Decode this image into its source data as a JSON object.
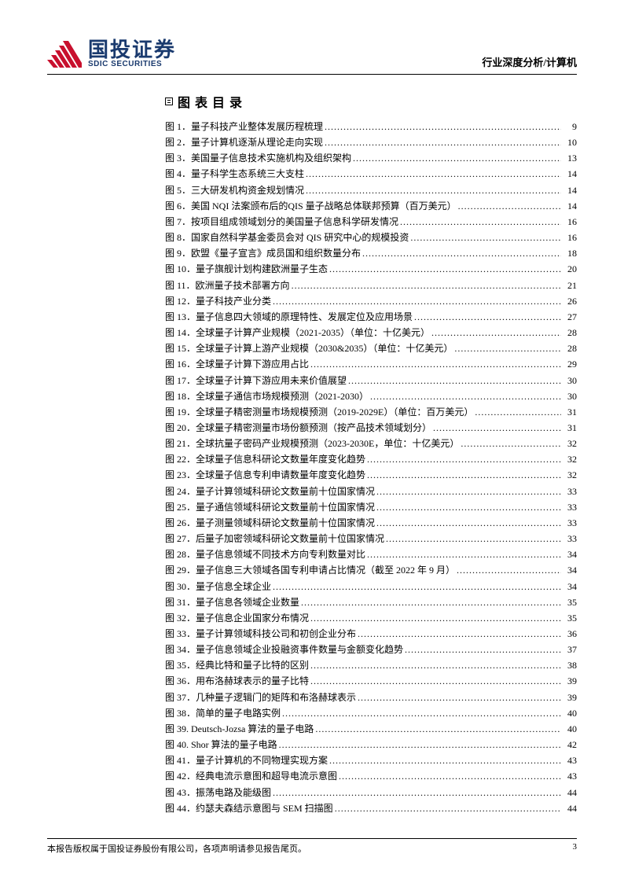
{
  "header": {
    "logo_zh": "国投证券",
    "logo_en": "SDIC SECURITIES",
    "right": "行业深度分析/计算机"
  },
  "toc_title": "图表目录",
  "toc": [
    {
      "label": "图 1．量子科技产业整体发展历程梳理",
      "page": "9"
    },
    {
      "label": "图 2．量子计算机逐渐从理论走向实现",
      "page": "10"
    },
    {
      "label": "图 3．美国量子信息技术实施机构及组织架构",
      "page": "13"
    },
    {
      "label": "图 4．量子科学生态系统三大支柱",
      "page": "14"
    },
    {
      "label": "图 5．三大研发机构资金规划情况",
      "page": "14"
    },
    {
      "label": "图 6．美国 NQI 法案颁布后的QIS 量子战略总体联邦预算（百万美元）",
      "page": "14"
    },
    {
      "label": "图 7．按项目组成领域划分的美国量子信息科学研发情况",
      "page": "16"
    },
    {
      "label": "图 8．国家自然科学基金委员会对 QIS 研究中心的规模投资",
      "page": "16"
    },
    {
      "label": "图 9．欧盟《量子宣言》成员国和组织数量分布",
      "page": "18"
    },
    {
      "label": "图 10．量子旗舰计划构建欧洲量子生态",
      "page": "20"
    },
    {
      "label": "图 11．欧洲量子技术部署方向",
      "page": "21"
    },
    {
      "label": "图 12．量子科技产业分类",
      "page": "26"
    },
    {
      "label": "图 13．量子信息四大领域的原理特性、发展定位及应用场景",
      "page": "27"
    },
    {
      "label": "图 14．全球量子计算产业规模（2021-2035）（单位：十亿美元）",
      "page": "28"
    },
    {
      "label": "图 15．全球量子计算上游产业规模（2030&2035）（单位：十亿美元）",
      "page": "28"
    },
    {
      "label": "图 16．全球量子计算下游应用占比",
      "page": "29"
    },
    {
      "label": "图 17．全球量子计算下游应用未来价值展望",
      "page": "30"
    },
    {
      "label": "图 18．全球量子通信市场规模预测（2021-2030）",
      "page": "30"
    },
    {
      "label": "图 19．全球量子精密测量市场规模预测（2019-2029E）（单位：百万美元）",
      "page": "31"
    },
    {
      "label": "图 20．全球量子精密测量市场份额预测（按产品技术领域划分）",
      "page": "31"
    },
    {
      "label": "图 21．全球抗量子密码产业规模预测（2023-2030E，单位：十亿美元）",
      "page": "32"
    },
    {
      "label": "图 22．全球量子信息科研论文数量年度变化趋势",
      "page": "32"
    },
    {
      "label": "图 23．全球量子信息专利申请数量年度变化趋势",
      "page": "32"
    },
    {
      "label": "图 24．量子计算领域科研论文数量前十位国家情况",
      "page": "33"
    },
    {
      "label": "图 25．量子通信领域科研论文数量前十位国家情况",
      "page": "33"
    },
    {
      "label": "图 26．量子测量领域科研论文数量前十位国家情况",
      "page": "33"
    },
    {
      "label": "图 27．后量子加密领域科研论文数量前十位国家情况",
      "page": "33"
    },
    {
      "label": "图 28．量子信息领域不同技术方向专利数量对比",
      "page": "34"
    },
    {
      "label": "图 29．量子信息三大领域各国专利申请占比情况（截至 2022 年 9 月）",
      "page": "34"
    },
    {
      "label": "图 30．量子信息全球企业",
      "page": "34"
    },
    {
      "label": "图 31．量子信息各领域企业数量",
      "page": "35"
    },
    {
      "label": "图 32．量子信息企业国家分布情况",
      "page": "35"
    },
    {
      "label": "图 33．量子计算领域科技公司和初创企业分布",
      "page": "36"
    },
    {
      "label": "图 34．量子信息领域企业投融资事件数量与金额变化趋势",
      "page": "37"
    },
    {
      "label": "图 35．经典比特和量子比特的区别",
      "page": "38"
    },
    {
      "label": "图 36．用布洛赫球表示的量子比特",
      "page": "39"
    },
    {
      "label": "图 37．几种量子逻辑门的矩阵和布洛赫球表示",
      "page": "39"
    },
    {
      "label": "图 38．简单的量子电路实例",
      "page": "40"
    },
    {
      "label": "图 39. Deutsch-Jozsa 算法的量子电路",
      "page": "40"
    },
    {
      "label": "图 40. Shor 算法的量子电路",
      "page": "42"
    },
    {
      "label": "图 41．量子计算机的不同物理实现方案",
      "page": "43"
    },
    {
      "label": "图 42．经典电流示意图和超导电流示意图",
      "page": "43"
    },
    {
      "label": "图 43．振荡电路及能级图",
      "page": "44"
    },
    {
      "label": "图 44．约瑟夫森结示意图与 SEM 扫描图",
      "page": "44"
    }
  ],
  "footer": {
    "left": "本报告版权属于国投证券股份有限公司，各项声明请参见报告尾页。",
    "right": "3"
  }
}
